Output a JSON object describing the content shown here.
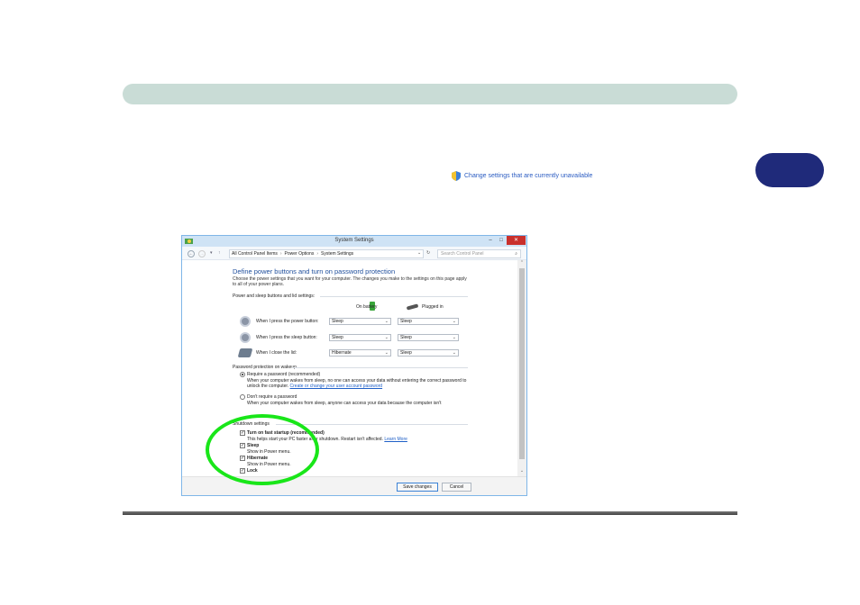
{
  "change_settings_link": "Change settings that are currently unavailable",
  "window": {
    "title": "System Settings",
    "controls": {
      "minimize": "–",
      "maximize": "□",
      "close": "✕"
    },
    "breadcrumb": [
      "All Control Panel Items",
      "Power Options",
      "System Settings"
    ],
    "search_placeholder": "Search Control Panel",
    "heading": "Define power buttons and turn on password protection",
    "description": "Choose the power settings that you want for your computer. The changes you make to the settings on this page apply to all of your power plans.",
    "power_section": {
      "title": "Power and sleep buttons and lid settings:",
      "col_battery": "On battery",
      "col_plugged": "Plugged in",
      "rows": [
        {
          "label": "When I press the power button:",
          "battery": "Sleep",
          "plugged": "Sleep"
        },
        {
          "label": "When I press the sleep button:",
          "battery": "Sleep",
          "plugged": "Sleep"
        },
        {
          "label": "When I close the lid:",
          "battery": "Hibernate",
          "plugged": "Sleep"
        }
      ]
    },
    "password_section": {
      "title": "Password protection on wakeup",
      "require_label": "Require a password (recommended)",
      "require_desc": "When your computer wakes from sleep, no one can access your data without entering the correct password to unlock the computer.",
      "require_link": "Create or change your user account password",
      "norequire_label": "Don't require a password",
      "norequire_desc": "When your computer wakes from sleep, anyone can access your data because the computer isn't"
    },
    "shutdown_section": {
      "title": "Shutdown settings",
      "fast_startup_label": "Turn on fast startup (recommended)",
      "fast_startup_desc": "This helps start your PC faster after shutdown. Restart isn't affected.",
      "learn_more": "Learn More",
      "sleep_label": "Sleep",
      "sleep_desc": "Show in Power menu.",
      "hibernate_label": "Hibernate",
      "hibernate_desc": "Show in Power menu.",
      "lock_label": "Lock"
    },
    "save_button": "Save changes",
    "cancel_button": "Cancel"
  },
  "colors": {
    "header_bar": "#c9dcd6",
    "chapter_tab": "#1f2a7a",
    "highlight": "#19e619",
    "link": "#1e5fc7"
  }
}
